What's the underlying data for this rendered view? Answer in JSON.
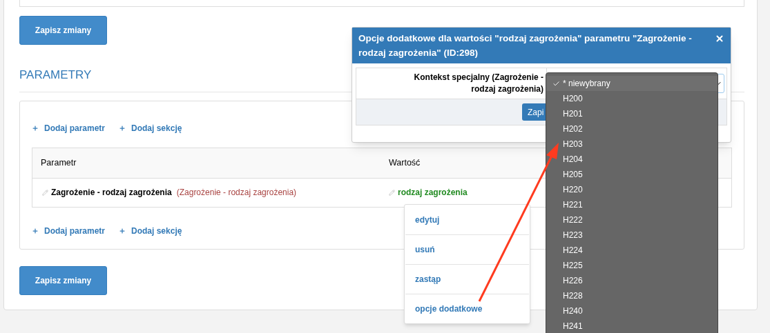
{
  "top_button": "Zapisz zmiany",
  "section_title": "PARAMETRY",
  "panel": {
    "top_links": [
      "Dodaj parametr",
      "Dodaj sekcję"
    ],
    "table": {
      "columns": [
        "Parametr",
        "Wartość"
      ],
      "rows": [
        {
          "parameter": "Zagrożenie - rodzaj zagrożenia",
          "parameter_note": "(Zagrożenie - rodzaj zagrożenia)",
          "value": "rodzaj zagrożenia"
        }
      ]
    },
    "bottom_links": [
      "Dodaj parametr",
      "Dodaj sekcję"
    ]
  },
  "bottom_button": "Zapisz zmiany",
  "context_menu": {
    "items": [
      "edytuj",
      "usuń",
      "zastąp",
      "opcje dodatkowe"
    ]
  },
  "modal": {
    "title": "Opcje dodatkowe dla wartości \"rodzaj zagrożenia\" parametru \"Zagrożenie - rodzaj zagrożenia\" (ID:298)",
    "field_label": "Kontekst specjalny (Zagrożenie - rodzaj zagrożenia)",
    "save_button": "Zapi",
    "dropdown": {
      "options": [
        {
          "label": "* niewybrany",
          "selected": true
        },
        {
          "label": "H200",
          "selected": false
        },
        {
          "label": "H201",
          "selected": false
        },
        {
          "label": "H202",
          "selected": false
        },
        {
          "label": "H203",
          "selected": false
        },
        {
          "label": "H204",
          "selected": false
        },
        {
          "label": "H205",
          "selected": false
        },
        {
          "label": "H220",
          "selected": false
        },
        {
          "label": "H221",
          "selected": false
        },
        {
          "label": "H222",
          "selected": false
        },
        {
          "label": "H223",
          "selected": false
        },
        {
          "label": "H224",
          "selected": false
        },
        {
          "label": "H225",
          "selected": false
        },
        {
          "label": "H226",
          "selected": false
        },
        {
          "label": "H228",
          "selected": false
        },
        {
          "label": "H240",
          "selected": false
        },
        {
          "label": "H241",
          "selected": false
        }
      ]
    }
  }
}
